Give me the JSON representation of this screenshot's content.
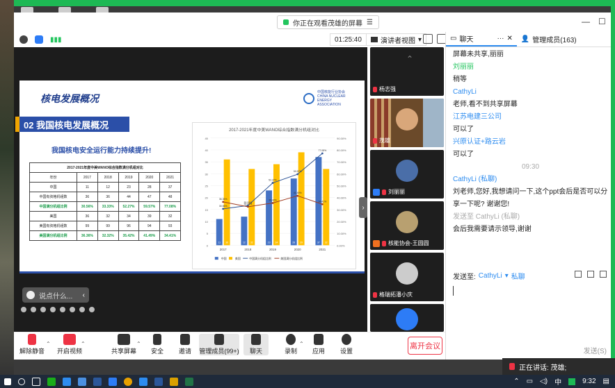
{
  "share_banner": {
    "text": "你正在观看茂雄的屏幕"
  },
  "topbar": {
    "timer": "01:25:40",
    "view_label": "演讲者视图"
  },
  "slide": {
    "title": "核电发展概况",
    "logo_text": "中国核能行业协会 CHINA NUCLEAR ENERGY ASSOCIATION",
    "section_heading": "02 我国核电发展概况",
    "subtitle": "我国核电安全运行能力持续提升!",
    "table": {
      "caption": "2017-2021年度中美WANO综合指数满分机组对比",
      "header": [
        "年份",
        "2017",
        "2018",
        "2019",
        "2020",
        "2021"
      ],
      "rows": [
        {
          "cells": [
            "中国",
            "11",
            "12",
            "23",
            "28",
            "37"
          ],
          "green": false
        },
        {
          "cells": [
            "中国有资格机组数",
            "36",
            "36",
            "44",
            "47",
            "48"
          ],
          "green": false
        },
        {
          "cells": [
            "中国满分机组比例",
            "30.56%",
            "33.33%",
            "52.27%",
            "59.57%",
            "77.08%"
          ],
          "green": true
        },
        {
          "cells": [
            "美国",
            "36",
            "32",
            "34",
            "39",
            "32"
          ],
          "green": false
        },
        {
          "cells": [
            "美国有资格机组数",
            "99",
            "99",
            "96",
            "94",
            "93"
          ],
          "green": false
        },
        {
          "cells": [
            "美国满分机组比例",
            "36.36%",
            "32.32%",
            "35.42%",
            "41.49%",
            "34.41%"
          ],
          "green": true
        }
      ]
    }
  },
  "chart_data": {
    "type": "bar",
    "title": "2017-2021年度中美WANO综合指数满分机组对比",
    "categories": [
      "2017",
      "2018",
      "2019",
      "2020",
      "2021"
    ],
    "series": [
      {
        "name": "中国",
        "values": [
          11,
          12,
          23,
          28,
          37
        ],
        "color": "#4472c4"
      },
      {
        "name": "美国",
        "values": [
          36,
          32,
          34,
          39,
          32
        ],
        "color": "#ffc000"
      }
    ],
    "line_series": [
      {
        "name": "中国满分机组比例",
        "values": [
          30.56,
          33.33,
          52.27,
          59.57,
          77.08
        ],
        "color": "#2f5597"
      },
      {
        "name": "美国满分机组比例",
        "values": [
          36.36,
          32.32,
          35.42,
          41.49,
          34.41
        ],
        "color": "#9e3a20"
      }
    ],
    "ylim": [
      0,
      45
    ],
    "y2lim": [
      0,
      90
    ],
    "y_ticks": [
      "0",
      "5",
      "10",
      "15",
      "20",
      "25",
      "30",
      "35",
      "40",
      "45"
    ],
    "y2_ticks": [
      "0.00%",
      "10.00%",
      "20.00%",
      "30.00%",
      "40.00%",
      "50.00%",
      "60.00%",
      "70.00%",
      "80.00%",
      "90.00%"
    ],
    "legend_position": "bottom"
  },
  "say_box": {
    "placeholder": "说点什么..."
  },
  "participants": [
    {
      "name": "杨志强"
    },
    {
      "name": "茂雄"
    },
    {
      "name": "刘丽丽"
    },
    {
      "name": "核能协会-王圆圆"
    },
    {
      "name": "格瑞拓潘小庆"
    }
  ],
  "chat": {
    "tab_chat": "聊天",
    "tab_members": "管理成员(163)",
    "messages": [
      {
        "sender": "",
        "text": "屏幕未共享,丽丽"
      },
      {
        "sender": "刘丽丽",
        "text": "稍等"
      },
      {
        "sender": "CathyLi",
        "text": "老师,看不到共享屏幕"
      },
      {
        "sender": "江苏电建三公司",
        "text": "可以了"
      },
      {
        "sender": "兴原认证+路云岩",
        "text": "可以了"
      }
    ],
    "time_divider": "09:30",
    "private_header": "CathyLi (私聊)",
    "private_msg_1": "刘老师,您好,我想请问一下,这个ppt会后是否可以分",
    "private_msg_1b": "享一下呢? 谢谢您!",
    "sent_to_label": "发送至 CathyLi (私聊)",
    "private_msg_2": "会后我需要请示领导,谢谢",
    "send_to": "发送至:",
    "send_to_target": "CathyLi",
    "send_to_mode": "私聊",
    "send_button": "发送(S)"
  },
  "toolbar": {
    "mute": "解除静音",
    "video": "开启视频",
    "share": "共享屏幕",
    "security": "安全",
    "invite": "邀请",
    "members": "管理成员(99+)",
    "chat": "聊天",
    "record": "录制",
    "apps": "应用",
    "settings": "设置",
    "leave": "离开会议"
  },
  "speaker_toast": "正在讲话: 茂雄;",
  "taskbar": {
    "ime": "中",
    "clock": "9:32"
  }
}
